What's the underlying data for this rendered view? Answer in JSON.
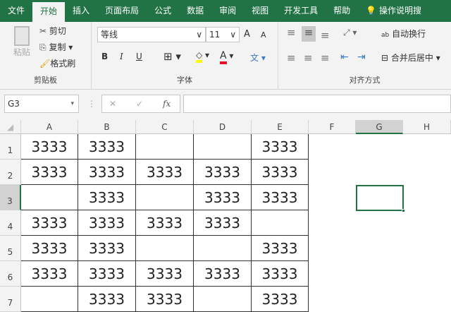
{
  "tabs": [
    "文件",
    "开始",
    "插入",
    "页面布局",
    "公式",
    "数据",
    "审阅",
    "视图",
    "开发工具",
    "帮助"
  ],
  "tell_me": "操作说明搜",
  "clipboard": {
    "paste": "粘贴",
    "cut": "剪切",
    "copy": "复制",
    "format_painter": "格式刷",
    "label": "剪贴板"
  },
  "font": {
    "name": "等线",
    "size": "11",
    "bold": "B",
    "italic": "I",
    "underline": "U",
    "font_color": "A",
    "pinyin": "文",
    "label": "字体",
    "fill_color": "#ffff00",
    "text_color": "#e81123"
  },
  "alignment": {
    "wrap": "自动换行",
    "merge": "合并后居中",
    "label": "对齐方式"
  },
  "formula_bar": {
    "name_box": "G3",
    "fx": "fx",
    "value": ""
  },
  "columns": [
    "A",
    "B",
    "C",
    "D",
    "E",
    "F",
    "G",
    "H"
  ],
  "rows": [
    "1",
    "2",
    "3",
    "4",
    "5",
    "6",
    "7"
  ],
  "cells": [
    [
      "3333",
      "3333",
      "",
      "",
      "3333"
    ],
    [
      "3333",
      "3333",
      "3333",
      "3333",
      "3333"
    ],
    [
      "",
      "3333",
      "",
      "3333",
      "3333"
    ],
    [
      "3333",
      "3333",
      "3333",
      "3333",
      ""
    ],
    [
      "3333",
      "3333",
      "",
      "",
      "3333"
    ],
    [
      "3333",
      "3333",
      "3333",
      "3333",
      "3333"
    ],
    [
      "",
      "3333",
      "3333",
      "",
      "3333"
    ]
  ],
  "selected_cell": "G3"
}
